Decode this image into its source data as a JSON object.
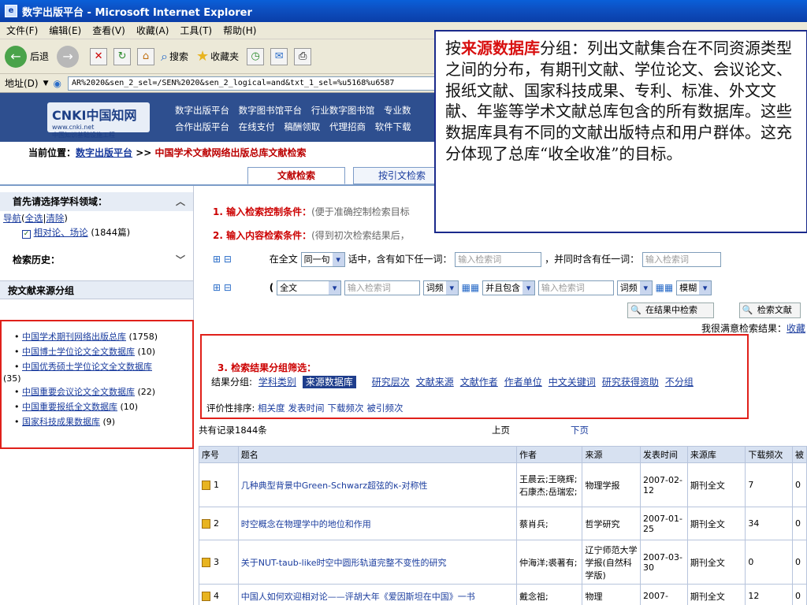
{
  "window": {
    "title": "数字出版平台 - Microsoft Internet Explorer"
  },
  "menu": [
    "文件(F)",
    "编辑(E)",
    "查看(V)",
    "收藏(A)",
    "工具(T)",
    "帮助(H)"
  ],
  "toolbar": {
    "back": "后退",
    "search": "搜索",
    "favorites": "收藏夹"
  },
  "address": {
    "label": "地址(D)",
    "value": "AR%2020&sen_2_sel=/SEN%2020&sen_2_logical=and&txt_1_sel=%u5168%u6587"
  },
  "header": {
    "logo": "CNKI中国知网",
    "logo_url": "www.cnki.net",
    "logo_sub": "中国知识基础设施工程",
    "links_row1": [
      "数字出版平台",
      "数字图书馆平台",
      "行业数字图书馆",
      "专业数"
    ],
    "links_row2": [
      "合作出版平台",
      "在线支付",
      "稿酬领取",
      "代理招商",
      "软件下载"
    ]
  },
  "breadcrumb": {
    "label": "当前位置：",
    "link": "数字出版平台",
    "sep": " >> ",
    "current": "中国学术文献网络出版总库文献检索"
  },
  "tabs": [
    "文献检索",
    "按引文检索"
  ],
  "left": {
    "field_heading": "首先请选择学科领域：",
    "nav_links": [
      "导航",
      "全选",
      "清除"
    ],
    "checked_field": "相对论、场论",
    "checked_field_count": "(1844篇)",
    "history_heading": "检索历史：",
    "source_group_heading": "按文献来源分组",
    "source_items": [
      {
        "name": "中国学术期刊网络出版总库",
        "count": "(1758)"
      },
      {
        "name": "中国博士学位论文全文数据库",
        "count": "(10)"
      },
      {
        "name": "中国优秀硕士学位论文全文数据库",
        "count": "(35)"
      },
      {
        "name": "中国重要会议论文全文数据库",
        "count": "(22)"
      },
      {
        "name": "中国重要报纸全文数据库",
        "count": "(10)"
      },
      {
        "name": "国家科技成果数据库",
        "count": "(9)"
      }
    ]
  },
  "main": {
    "step1": "1. 输入检索控制条件：",
    "step1_hint": "(便于准确控制检索目标",
    "step2": "2. 输入内容检索条件：",
    "step2_hint": "(得到初次检索结果后，",
    "row1": {
      "prefix": "在全文",
      "sel": "同一句",
      "mid": "话中，含有如下任一词：",
      "input1": "输入检索词",
      "mid2": "，并同时含有任一词：",
      "input2": "输入检索词"
    },
    "row2": {
      "paren": "(",
      "field": "全文",
      "input1": "输入检索词",
      "freq1": "词频",
      "logic": "并且包含",
      "input2": "输入检索词",
      "freq2": "词频",
      "match": "模糊"
    },
    "btn_in_results": "在结果中检索",
    "btn_search": "检索文献",
    "satisfied": "我很满意检索结果：",
    "satisfied_link": "收藏",
    "step3": "3. 检索结果分组筛选：",
    "group_label": "结果分组:",
    "group_links": [
      "学科类别",
      "来源数据库",
      "研究层次",
      "文献来源",
      "文献作者",
      "作者单位",
      "中文关键词",
      "研究获得资助",
      "不分组"
    ],
    "sort_label": "评价性排序:",
    "sort_links": [
      "相关度",
      "发表时间",
      "下载频次",
      "被引频次"
    ],
    "total": "共有记录1844条",
    "prev": "上页",
    "next": "下页",
    "table_headers": [
      "序号",
      "题名",
      "作者",
      "来源",
      "发表时间",
      "来源库",
      "下载频次",
      "被"
    ],
    "rows": [
      {
        "no": "1",
        "title": "几种典型背景中Green-Schwarz超弦的κ-对称性",
        "author": "王晨云;王晓辉;石康杰;岳瑞宏;",
        "source": "物理学报",
        "date": "2007-02-12",
        "db": "期刊全文",
        "dl": "7",
        "cited": "0"
      },
      {
        "no": "2",
        "title": "时空概念在物理学中的地位和作用",
        "author": "蔡肖兵;",
        "source": "哲学研究",
        "date": "2007-01-25",
        "db": "期刊全文",
        "dl": "34",
        "cited": "0"
      },
      {
        "no": "3",
        "title": "关于NUT-taub-like时空中圆形轨道完整不变性的研究",
        "author": "仲海洋;裘著有;",
        "source": "辽宁师范大学学报(自然科学版)",
        "date": "2007-03-30",
        "db": "期刊全文",
        "dl": "0",
        "cited": "0"
      },
      {
        "no": "4",
        "title": "中国人如何欢迎相对论——评胡大年《爱因斯坦在中国》一书",
        "author": "戴念祖;",
        "source": "物理",
        "date": "2007-",
        "db": "期刊全文",
        "dl": "12",
        "cited": "0"
      }
    ]
  },
  "overlay": {
    "pre": "按",
    "highlight": "来源数据库",
    "post": "分组：列出文献集合在不同资源类型之间的分布，有期刊文献、学位论文、会议论文、报纸文献、国家科技成果、专利、标准、外文文献、年鉴等学术文献总库包含的所有数据库。这些数据库具有不同的文献出版特点和用户群体。这充分体现了总库“收全收准”的目标。"
  },
  "colors": {
    "highlight_box": "#e0201a",
    "accent": "#d81010",
    "link": "#1a3c9e"
  }
}
